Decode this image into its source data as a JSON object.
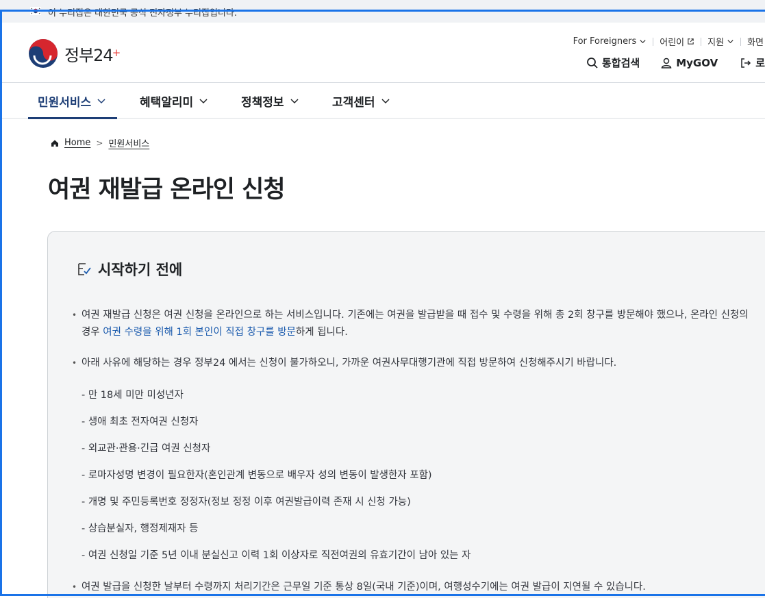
{
  "banner": {
    "text": "이 누리집은 대한민국 공식 전자정부 누리집입니다."
  },
  "logo": {
    "name": "정부24"
  },
  "util": {
    "foreigners": "For Foreigners",
    "kids": "어린이",
    "support": "지원",
    "screen": "화면"
  },
  "actions": {
    "search": "통합검색",
    "mygov": "MyGOV",
    "login": "로"
  },
  "nav": {
    "tabs": [
      {
        "label": "민원서비스"
      },
      {
        "label": "혜택알리미"
      },
      {
        "label": "정책정보"
      },
      {
        "label": "고객센터"
      }
    ]
  },
  "breadcrumb": {
    "home": "Home",
    "current": "민원서비스"
  },
  "page": {
    "title": "여권 재발급 온라인 신청"
  },
  "notice": {
    "heading": "시작하기 전에",
    "p1_before": "여권 재발급 신청은 여권 신청을 온라인으로 하는 서비스입니다. 기존에는 여권을 발급받을 때 접수 및 수령을 위해 총 2회 창구를 방문해야 했으나, 온라인 신청의 경우 ",
    "p1_highlight": "여권 수령을 위해 1회 본인이 직접 창구를 방문",
    "p1_after": "하게 됩니다.",
    "p2": "아래 사유에 해당하는 경우 정부24 에서는 신청이 불가하오니, 가까운 여권사무대행기관에 직접 방문하여 신청해주시기 바랍니다.",
    "reasons": [
      "- 만 18세 미만 미성년자",
      "- 생애 최초 전자여권 신청자",
      "- 외교관·관용·긴급 여권 신청자",
      "- 로마자성명 변경이 필요한자(혼인관계 변동으로 배우자 성의 변동이 발생한자 포함)",
      "- 개명 및 주민등록번호 정정자(정보 정정 이후 여권발급이력 존재 시 신청 가능)",
      "- 상습분실자, 행정제재자 등",
      "- 여권 신청일 기준 5년 이내 분실신고 이력 1회 이상자로 직전여권의 유효기간이 남아 있는 자"
    ],
    "p3": "여권 발급을 신청한 날부터 수령까지 처리기간은 근무일 기준 통상 8일(국내 기준)이며, 여행성수기에는 여권 발급이 지연될 수 있습니다."
  },
  "colors": {
    "selection": "#1a73e8",
    "nav_active": "#1d3e76",
    "link": "#1a5aad",
    "logo_red": "#e8413b",
    "logo_blue": "#1d3e76"
  }
}
